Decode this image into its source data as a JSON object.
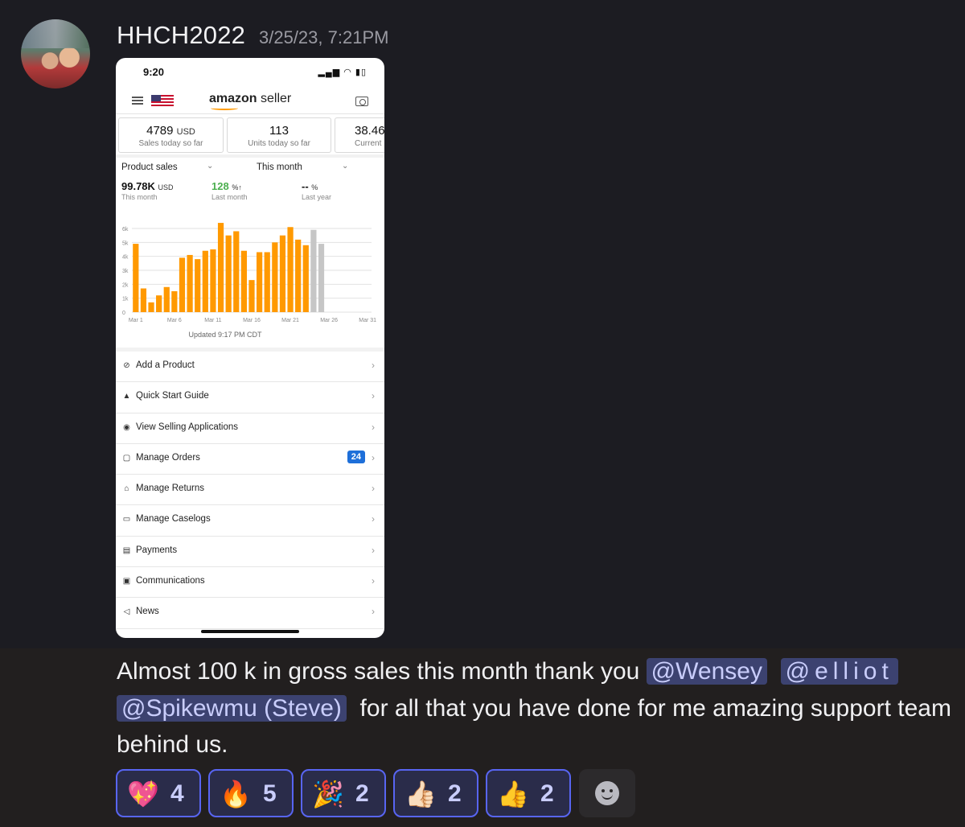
{
  "message": {
    "username": "HHCH2022",
    "timestamp": "3/25/23, 7:21PM",
    "text_1": "Almost 100 k in gross sales this month thank you",
    "mentions": [
      "@Wensey",
      "@elliot",
      "@Spikewmu (Steve)"
    ],
    "text_2": "for all that you have done for me amazing support team behind us."
  },
  "phone": {
    "status_time": "9:20",
    "brand_bold": "amazon",
    "brand_rest": " seller",
    "kpis": [
      {
        "value": "4789",
        "unit": "USD",
        "label": "Sales today so far"
      },
      {
        "value": "113",
        "unit": "",
        "label": "Units today so far"
      },
      {
        "value": "38.46",
        "unit": "",
        "label": "Current"
      }
    ],
    "sales_dropdown": "Product sales",
    "period_dropdown": "This month",
    "metrics": [
      {
        "value": "99.78K",
        "unit": "USD",
        "label": "This month"
      },
      {
        "value": "128",
        "unit": "%↑",
        "label": "Last month"
      },
      {
        "value": "--",
        "unit": "%",
        "label": "Last year"
      }
    ],
    "updated": "Updated 9:17 PM CDT",
    "menu": [
      {
        "icon": "tag-icon",
        "glyph": "⊘",
        "label": "Add a Product"
      },
      {
        "icon": "graduation-cap-icon",
        "glyph": "▲",
        "label": "Quick Start Guide"
      },
      {
        "icon": "eye-icon",
        "glyph": "◉",
        "label": "View Selling Applications"
      },
      {
        "icon": "box-icon",
        "glyph": "▢",
        "label": "Manage Orders",
        "badge": "24"
      },
      {
        "icon": "return-box-icon",
        "glyph": "⌂",
        "label": "Manage Returns"
      },
      {
        "icon": "chat-icon",
        "glyph": "▭",
        "label": "Manage Caselogs"
      },
      {
        "icon": "card-icon",
        "glyph": "▤",
        "label": "Payments"
      },
      {
        "icon": "messages-icon",
        "glyph": "▣",
        "label": "Communications"
      },
      {
        "icon": "megaphone-icon",
        "glyph": "◁",
        "label": "News"
      }
    ]
  },
  "chart_data": {
    "type": "bar",
    "title": "",
    "xlabel": "",
    "ylabel": "",
    "ylim": [
      0,
      6000
    ],
    "y_ticks": [
      "0",
      "1k",
      "2k",
      "3k",
      "4k",
      "5k",
      "6k"
    ],
    "x_tick_labels": [
      "Mar 1",
      "Mar 6",
      "Mar 11",
      "Mar 16",
      "Mar 21",
      "Mar 26",
      "Mar 31"
    ],
    "categories": [
      "Mar 1",
      "Mar 2",
      "Mar 3",
      "Mar 4",
      "Mar 5",
      "Mar 6",
      "Mar 7",
      "Mar 8",
      "Mar 9",
      "Mar 10",
      "Mar 11",
      "Mar 12",
      "Mar 13",
      "Mar 14",
      "Mar 15",
      "Mar 16",
      "Mar 17",
      "Mar 18",
      "Mar 19",
      "Mar 20",
      "Mar 21",
      "Mar 22",
      "Mar 23",
      "Mar 24",
      "Mar 25",
      "Mar 26"
    ],
    "values": [
      4900,
      1700,
      700,
      1200,
      1800,
      1500,
      3900,
      4100,
      3800,
      4400,
      4500,
      6400,
      5500,
      5800,
      4400,
      2300,
      4300,
      4300,
      5000,
      5500,
      6100,
      5200,
      4800,
      5900,
      4900,
      0
    ],
    "colors": {
      "actual": "#ff9900",
      "projected": "#c6c6c6"
    },
    "projected_from_index": 23
  },
  "reactions": [
    {
      "emoji": "💖",
      "icon": "sparkling-heart-icon",
      "count": "4"
    },
    {
      "emoji": "🔥",
      "icon": "fire-icon",
      "count": "5"
    },
    {
      "emoji": "🎉",
      "icon": "party-popper-icon",
      "count": "2"
    },
    {
      "emoji": "👍🏻",
      "icon": "thumbs-up-light-icon",
      "count": "2"
    },
    {
      "emoji": "👍",
      "icon": "thumbs-up-icon",
      "count": "2"
    }
  ]
}
